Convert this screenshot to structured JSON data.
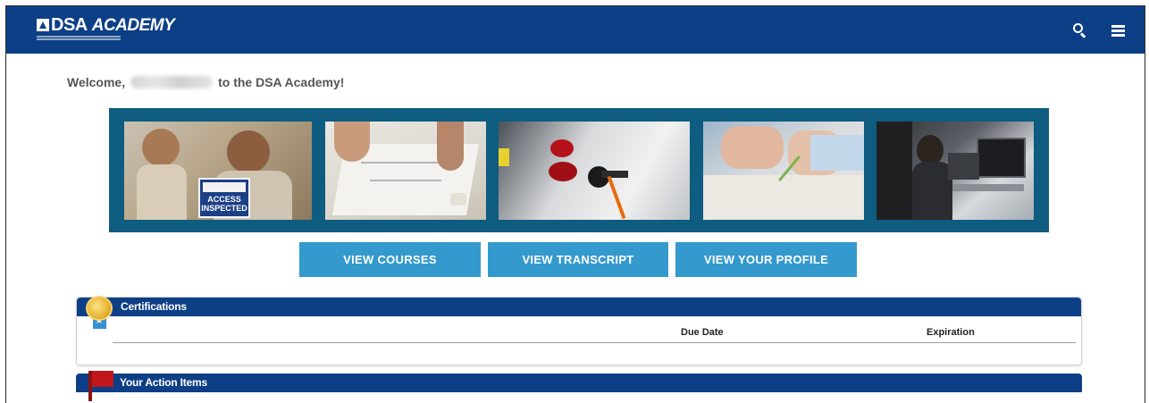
{
  "header": {
    "logo_text": "DSA",
    "logo_academy": "ACADEMY",
    "logo_subtext": "DIVISION OF THE STATE ARCHITECT",
    "search_icon": "search-icon",
    "menu_icon": "hamburger-menu-icon"
  },
  "welcome": {
    "prefix": "Welcome,",
    "suffix": "to the DSA Academy!"
  },
  "banner": {
    "images": [
      "photo-contractors-access",
      "photo-blueprints",
      "photo-ev-charging",
      "photo-form-writing",
      "photo-office-workers"
    ],
    "sign_line1": "ACCESS",
    "sign_line2": "INSPECTED"
  },
  "buttons": {
    "view_courses": "VIEW COURSES",
    "view_transcript": "VIEW TRANSCRIPT",
    "view_profile": "VIEW YOUR PROFILE"
  },
  "certifications": {
    "title": "Certifications",
    "icon": "medal-icon",
    "columns": [
      "Due Date",
      "Expiration"
    ]
  },
  "action_items": {
    "title": "Your Action Items",
    "icon": "red-flag-icon"
  },
  "colors": {
    "header_bg": "#0d3f86",
    "button_bg": "#3499cc",
    "banner_bg": "#0e5c7f"
  }
}
